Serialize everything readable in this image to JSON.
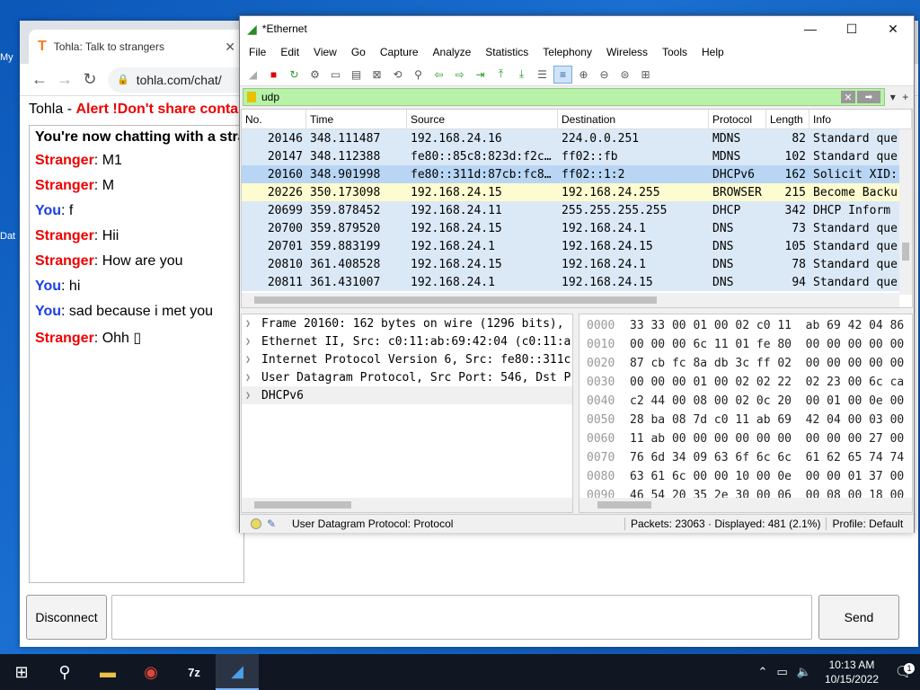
{
  "desktop": {
    "labels": [
      "My",
      "Dat"
    ]
  },
  "chrome": {
    "tab_title": "Tohla: Talk to strangers",
    "url": "tohla.com/chat/",
    "header_prefix": "Tohla - ",
    "header_alert": "Alert !Don't share conta",
    "intro": "You're now chatting with a stra",
    "messages": [
      {
        "who": "Stranger",
        "sep": ": ",
        "text": "M1"
      },
      {
        "who": "Stranger",
        "sep": ": ",
        "text": "M"
      },
      {
        "who": "You",
        "sep": ": ",
        "text": "f"
      },
      {
        "who": "Stranger",
        "sep": ": ",
        "text": "Hii"
      },
      {
        "who": "Stranger",
        "sep": ": ",
        "text": "How are you"
      },
      {
        "who": "You",
        "sep": ": ",
        "text": "hi"
      },
      {
        "who": "You",
        "sep": ": ",
        "text": "sad because i met you"
      },
      {
        "who": "Stranger",
        "sep": ": ",
        "text": "Ohh ▯"
      }
    ],
    "disconnect_label": "Disconnect",
    "send_label": "Send"
  },
  "wireshark": {
    "title": "*Ethernet",
    "menu": [
      "File",
      "Edit",
      "View",
      "Go",
      "Capture",
      "Analyze",
      "Statistics",
      "Telephony",
      "Wireless",
      "Tools",
      "Help"
    ],
    "filter": "udp",
    "columns": [
      "No.",
      "Time",
      "Source",
      "Destination",
      "Protocol",
      "Length",
      "Info"
    ],
    "packets": [
      {
        "no": "20146",
        "time": "348.111487",
        "src": "192.168.24.16",
        "dst": "224.0.0.251",
        "proto": "MDNS",
        "len": "82",
        "info": "Standard que",
        "bg": "#dbe9f7"
      },
      {
        "no": "20147",
        "time": "348.112388",
        "src": "fe80::85c8:823d:f2c…",
        "dst": "ff02::fb",
        "proto": "MDNS",
        "len": "102",
        "info": "Standard que",
        "bg": "#dbe9f7"
      },
      {
        "no": "20160",
        "time": "348.901998",
        "src": "fe80::311d:87cb:fc8…",
        "dst": "ff02::1:2",
        "proto": "DHCPv6",
        "len": "162",
        "info": "Solicit XID:",
        "bg": "#b8d6f4"
      },
      {
        "no": "20226",
        "time": "350.173098",
        "src": "192.168.24.15",
        "dst": "192.168.24.255",
        "proto": "BROWSER",
        "len": "215",
        "info": "Become Backu",
        "bg": "#fdfbd0"
      },
      {
        "no": "20699",
        "time": "359.878452",
        "src": "192.168.24.11",
        "dst": "255.255.255.255",
        "proto": "DHCP",
        "len": "342",
        "info": "DHCP Inform",
        "bg": "#dbe9f7"
      },
      {
        "no": "20700",
        "time": "359.879520",
        "src": "192.168.24.15",
        "dst": "192.168.24.1",
        "proto": "DNS",
        "len": "73",
        "info": "Standard que",
        "bg": "#dbe9f7"
      },
      {
        "no": "20701",
        "time": "359.883199",
        "src": "192.168.24.1",
        "dst": "192.168.24.15",
        "proto": "DNS",
        "len": "105",
        "info": "Standard que",
        "bg": "#dbe9f7"
      },
      {
        "no": "20810",
        "time": "361.408528",
        "src": "192.168.24.15",
        "dst": "192.168.24.1",
        "proto": "DNS",
        "len": "78",
        "info": "Standard que",
        "bg": "#dbe9f7"
      },
      {
        "no": "20811",
        "time": "361.431007",
        "src": "192.168.24.1",
        "dst": "192.168.24.15",
        "proto": "DNS",
        "len": "94",
        "info": "Standard que",
        "bg": "#dbe9f7"
      }
    ],
    "details": [
      "Frame 20160: 162 bytes on wire (1296 bits),",
      "Ethernet II, Src: c0:11:ab:69:42:04 (c0:11:a",
      "Internet Protocol Version 6, Src: fe80::311c",
      "User Datagram Protocol, Src Port: 546, Dst P",
      "DHCPv6"
    ],
    "bytes": [
      {
        "off": "0000",
        "hex": "33 33 00 01 00 02 c0 11  ab 69 42 04 86"
      },
      {
        "off": "0010",
        "hex": "00 00 00 6c 11 01 fe 80  00 00 00 00 00"
      },
      {
        "off": "0020",
        "hex": "87 cb fc 8a db 3c ff 02  00 00 00 00 00"
      },
      {
        "off": "0030",
        "hex": "00 00 00 01 00 02 02 22  02 23 00 6c ca"
      },
      {
        "off": "0040",
        "hex": "c2 44 00 08 00 02 0c 20  00 01 00 0e 00"
      },
      {
        "off": "0050",
        "hex": "28 ba 08 7d c0 11 ab 69  42 04 00 03 00"
      },
      {
        "off": "0060",
        "hex": "11 ab 00 00 00 00 00 00  00 00 00 27 00"
      },
      {
        "off": "0070",
        "hex": "76 6d 34 09 63 6f 6c 6c  61 62 65 74 74"
      },
      {
        "off": "0080",
        "hex": "63 61 6c 00 00 10 00 0e  00 00 01 37 00"
      },
      {
        "off": "0090",
        "hex": "46 54 20 35 2e 30 00 06  00 08 00 18 00"
      }
    ],
    "status_field": "User Datagram Protocol: Protocol",
    "status_packets": "Packets: 23063 · Displayed: 481 (2.1%)",
    "status_profile": "Profile: Default"
  },
  "taskbar": {
    "time": "10:13 AM",
    "date": "10/15/2022",
    "notif_count": "1"
  }
}
